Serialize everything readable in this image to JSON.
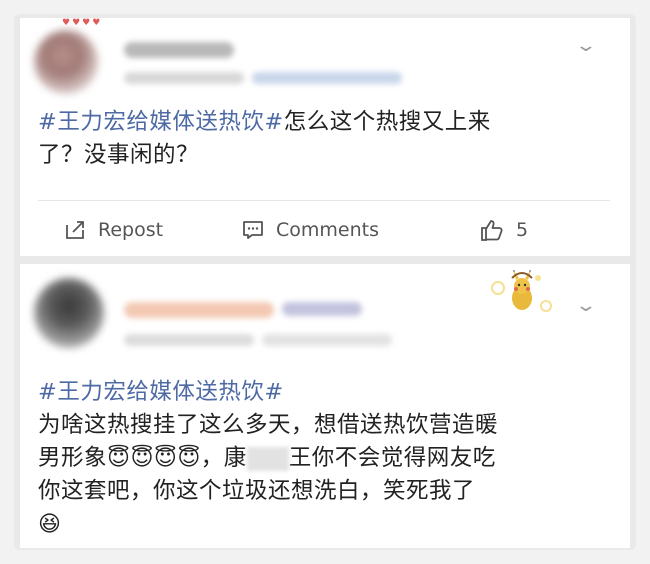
{
  "posts": [
    {
      "hashtag": "#王力宏给媒体送热饮#",
      "text_line1_rest": "怎么这个热搜又上来",
      "text_line2": "了？没事闲的？",
      "actions": {
        "repost_label": "Repost",
        "comments_label": "Comments",
        "like_count": "5"
      }
    },
    {
      "hashtag": "#王力宏给媒体送热饮#",
      "line2": "为啥这热搜挂了这么多天，想借送热饮营造暖",
      "line3_start": "男形象",
      "emoji_group": "😇😇😇😇",
      "line3_comma": "，",
      "line3_name_prefix": "康",
      "line3_rest": "王你不会觉得网友吃",
      "line4": "你这套吧，你这个垃圾还想洗白，笑死我了",
      "line5_emoji": "😆"
    }
  ],
  "colors": {
    "hashtag": "#4d6aa4",
    "text": "#222222",
    "action": "#555555"
  }
}
